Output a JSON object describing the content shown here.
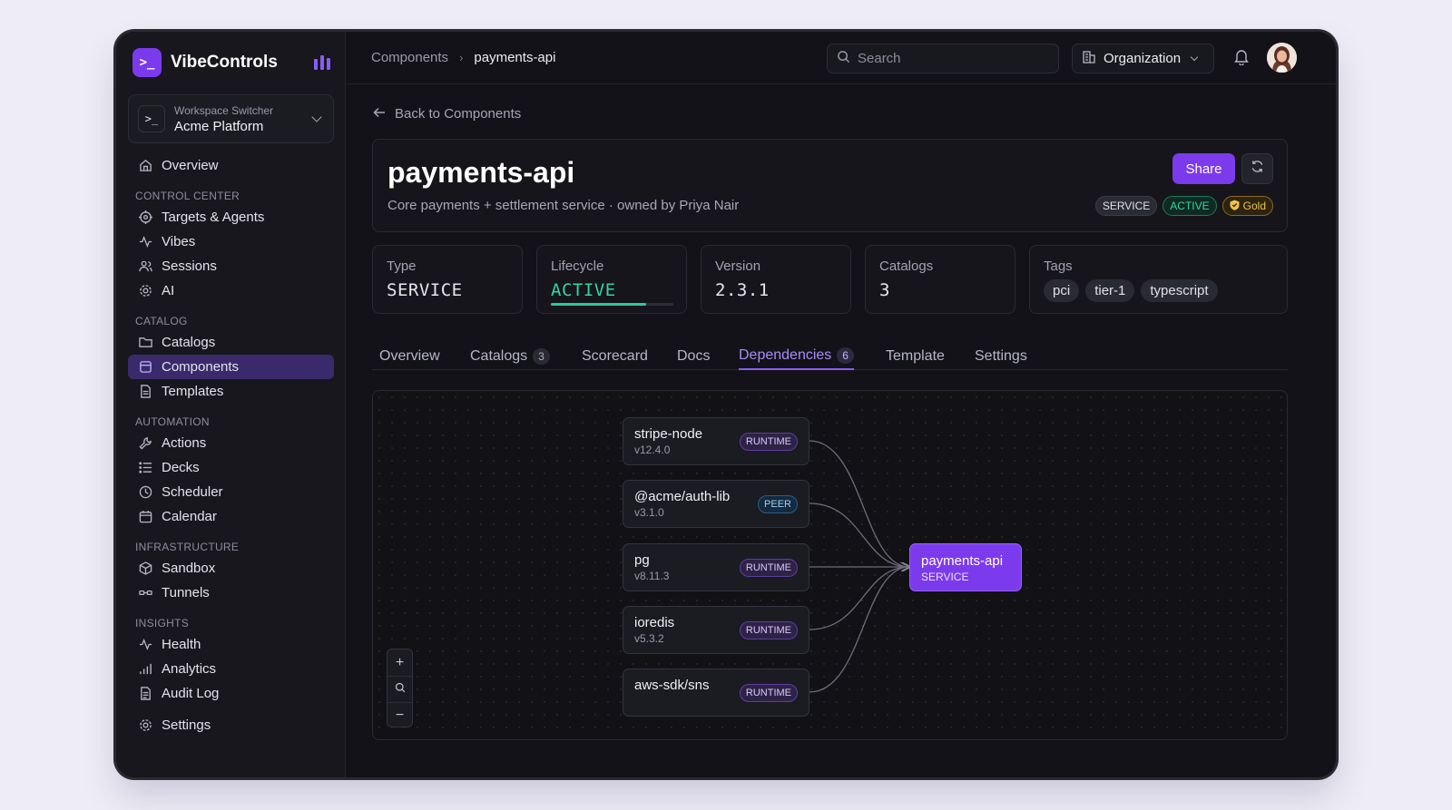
{
  "brand": {
    "name": "VibeControls",
    "logo_glyph": ">_"
  },
  "workspace": {
    "label": "Workspace Switcher",
    "name": "Acme Platform",
    "icon_glyph": ">_"
  },
  "nav": {
    "overview": "Overview",
    "sections": [
      {
        "title": "CONTROL CENTER",
        "items": [
          "Targets & Agents",
          "Vibes",
          "Sessions",
          "AI"
        ]
      },
      {
        "title": "CATALOG",
        "items": [
          "Catalogs",
          "Components",
          "Templates"
        ]
      },
      {
        "title": "AUTOMATION",
        "items": [
          "Actions",
          "Decks",
          "Scheduler",
          "Calendar"
        ]
      },
      {
        "title": "INFRASTRUCTURE",
        "items": [
          "Sandbox",
          "Tunnels"
        ]
      },
      {
        "title": "INSIGHTS",
        "items": [
          "Health",
          "Analytics",
          "Audit Log"
        ]
      }
    ],
    "settings": "Settings",
    "active": "Components"
  },
  "topbar": {
    "breadcrumb": [
      "Components",
      "payments-api"
    ],
    "search_placeholder": "Search",
    "org_label": "Organization"
  },
  "back_link": "Back to Components",
  "component": {
    "name": "payments-api",
    "description": "Core payments + settlement service · owned by Priya Nair",
    "share_label": "Share",
    "badges": {
      "type": "SERVICE",
      "status": "ACTIVE",
      "tier": "Gold"
    }
  },
  "stats": {
    "type": {
      "label": "Type",
      "value": "SERVICE"
    },
    "lifecycle": {
      "label": "Lifecycle",
      "value": "ACTIVE",
      "progress_pct": 78
    },
    "version": {
      "label": "Version",
      "value": "2.3.1"
    },
    "catalogs": {
      "label": "Catalogs",
      "value": "3"
    },
    "tags": {
      "label": "Tags",
      "values": [
        "pci",
        "tier-1",
        "typescript"
      ]
    }
  },
  "tabs": [
    {
      "label": "Overview"
    },
    {
      "label": "Catalogs",
      "count": "3"
    },
    {
      "label": "Scorecard"
    },
    {
      "label": "Docs"
    },
    {
      "label": "Dependencies",
      "count": "6",
      "active": true
    },
    {
      "label": "Template"
    },
    {
      "label": "Settings"
    }
  ],
  "dependencies": [
    {
      "name": "stripe-node",
      "version": "v12.4.0",
      "kind": "RUNTIME"
    },
    {
      "name": "@acme/auth-lib",
      "version": "v3.1.0",
      "kind": "PEER"
    },
    {
      "name": "pg",
      "version": "v8.11.3",
      "kind": "RUNTIME"
    },
    {
      "name": "ioredis",
      "version": "v5.3.2",
      "kind": "RUNTIME"
    },
    {
      "name": "aws-sdk/sns",
      "version": "",
      "kind": "RUNTIME"
    }
  ],
  "graph_target": {
    "name": "payments-api",
    "type": "SERVICE"
  },
  "zoom": {
    "in": "+",
    "fit": "search-icon",
    "out": "−"
  },
  "colors": {
    "accent": "#7c3aed",
    "active_green": "#38d39f",
    "gold": "#f2c14e",
    "background": "#121218"
  }
}
